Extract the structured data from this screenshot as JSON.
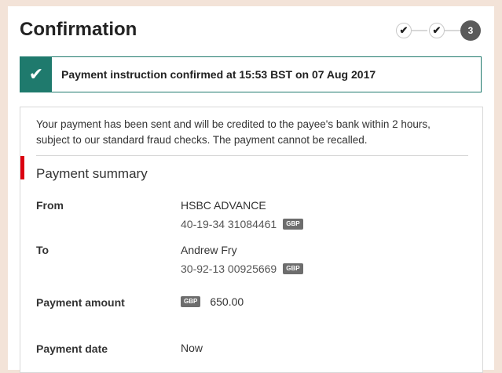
{
  "page": {
    "title": "Confirmation"
  },
  "steps": {
    "done_icon": "check-icon",
    "current": "3"
  },
  "banner": {
    "icon": "check-icon",
    "text": "Payment instruction confirmed at 15:53 BST on 07 Aug 2017",
    "color": "#1f7a6d"
  },
  "notice": "Your payment has been sent and will be credited to the payee's bank within 2 hours, subject to our standard fraud checks. The payment cannot be recalled.",
  "summary": {
    "title": "Payment summary",
    "accent_color": "#db0011",
    "from": {
      "label": "From",
      "name": "HSBC ADVANCE",
      "account": "40-19-34 31084461",
      "currency": "GBP"
    },
    "to": {
      "label": "To",
      "name": "Andrew Fry",
      "account": "30-92-13 00925669",
      "currency": "GBP"
    },
    "amount": {
      "label": "Payment amount",
      "currency": "GBP",
      "value": "650.00"
    },
    "date": {
      "label": "Payment date",
      "value": "Now"
    }
  }
}
